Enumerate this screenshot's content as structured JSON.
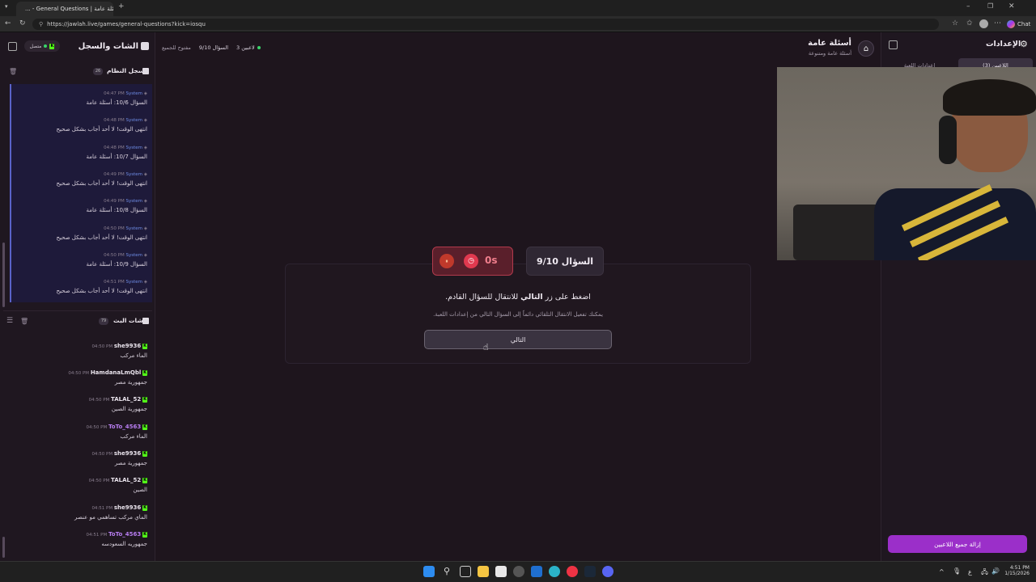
{
  "browser": {
    "tab_title": "أسئلة عامة | General Questions - ...",
    "url": "https://jawlah.live/games/general-questions?kick=iosqu",
    "chat_label": "Chat"
  },
  "left_panel": {
    "title": "الشات والسجل",
    "connected_label": "متصل",
    "system_log": {
      "title": "سجل النظام",
      "count": "26",
      "items": [
        {
          "sender": "System",
          "time": "04:47 PM",
          "text": "السؤال 10/6: أسئلة عامة"
        },
        {
          "sender": "System",
          "time": "04:48 PM",
          "text": "انتهى الوقت! لا أحد أجاب بشكل صحيح"
        },
        {
          "sender": "System",
          "time": "04:48 PM",
          "text": "السؤال 10/7: أسئلة عامة"
        },
        {
          "sender": "System",
          "time": "04:49 PM",
          "text": "انتهى الوقت! لا أحد أجاب بشكل صحيح"
        },
        {
          "sender": "System",
          "time": "04:49 PM",
          "text": "السؤال 10/8: أسئلة عامة"
        },
        {
          "sender": "System",
          "time": "04:50 PM",
          "text": "انتهى الوقت! لا أحد أجاب بشكل صحيح"
        },
        {
          "sender": "System",
          "time": "04:50 PM",
          "text": "السؤال 10/9: أسئلة عامة"
        },
        {
          "sender": "System",
          "time": "04:51 PM",
          "text": "انتهى الوقت! لا أحد أجاب بشكل صحيح"
        }
      ]
    },
    "stream_chat": {
      "title": "شات البث",
      "count": "79",
      "items": [
        {
          "user": "she9936",
          "time": "04:50 PM",
          "text": "الماء مركب",
          "color": "#e9e3ec"
        },
        {
          "user": "HamdanaLmQbl",
          "time": "04:50 PM",
          "text": "جمهورية مصر",
          "color": "#e9e3ec"
        },
        {
          "user": "TALAL_52",
          "time": "04:50 PM",
          "text": "جمهورية الصين",
          "color": "#e9e3ec"
        },
        {
          "user": "ToTo_4563",
          "time": "04:50 PM",
          "text": "الماء مركب",
          "color": "#b77df0"
        },
        {
          "user": "she9936",
          "time": "04:50 PM",
          "text": "جمهورية مصر",
          "color": "#e9e3ec"
        },
        {
          "user": "TALAL_52",
          "time": "04:50 PM",
          "text": "الصين",
          "color": "#e9e3ec"
        },
        {
          "user": "she9936",
          "time": "04:51 PM",
          "text": "الماي مركب تساهمي مو عنصر",
          "color": "#e9e3ec"
        },
        {
          "user": "ToTo_4563",
          "time": "04:51 PM",
          "text": "جمهوريه السعودسه",
          "color": "#b77df0"
        }
      ]
    }
  },
  "top_status": {
    "players": "3 لاعبين",
    "question": "السؤال 9/10",
    "mode": "مفتوح للجميع"
  },
  "game_header": {
    "title": "أسئلة عامة",
    "subtitle": "أسئلة عامة ومتنوعة"
  },
  "question_panel": {
    "timer": "0s",
    "question_label": "السؤال 9/10",
    "prompt_prefix": "اضغط على زر ",
    "prompt_bold": "التالي",
    "prompt_suffix": " للانتقال للسؤال القادم.",
    "hint": "يمكنك تفعيل الانتقال التلقائي دائماً إلى السؤال التالي من إعدادات اللعبة.",
    "next_label": "التالي"
  },
  "right_panel": {
    "title": "الإعدادات",
    "tab_players": "اللاعبين (3)",
    "tab_settings": "إعدادات اللعبة",
    "remove_all_label": "إزالة جميع اللاعبين"
  },
  "taskbar": {
    "time": "4:51 PM",
    "date": "1/15/2026"
  },
  "colors": {
    "accent_purple": "#9b2fc9",
    "kick_green": "#53fc18",
    "system_blue": "#6f8ee8",
    "timer_red": "#e0394f"
  }
}
